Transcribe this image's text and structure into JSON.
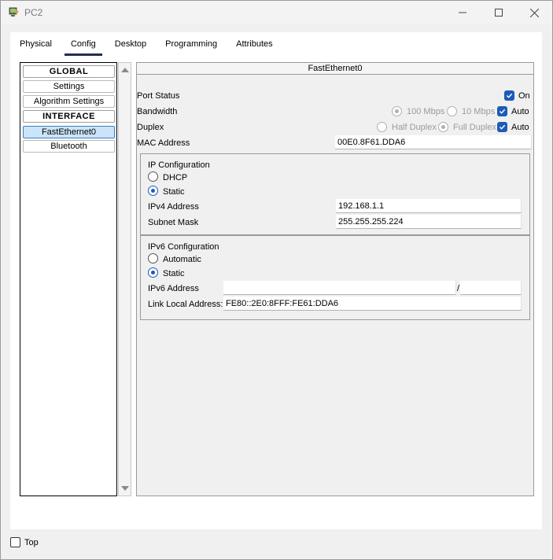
{
  "window": {
    "title": "PC2"
  },
  "tabs": [
    "Physical",
    "Config",
    "Desktop",
    "Programming",
    "Attributes"
  ],
  "sidebar": {
    "items": [
      {
        "label": "GLOBAL",
        "kind": "header"
      },
      {
        "label": "Settings",
        "kind": "item"
      },
      {
        "label": "Algorithm Settings",
        "kind": "item"
      },
      {
        "label": "INTERFACE",
        "kind": "header"
      },
      {
        "label": "FastEthernet0",
        "kind": "selected"
      },
      {
        "label": "Bluetooth",
        "kind": "item"
      }
    ]
  },
  "panel": {
    "title": "FastEthernet0",
    "port_status": {
      "label": "Port Status",
      "on_label": "On",
      "on_checked": true
    },
    "bandwidth": {
      "label": "Bandwidth",
      "opt_100": "100 Mbps",
      "opt_10": "10 Mbps",
      "auto_label": "Auto"
    },
    "duplex": {
      "label": "Duplex",
      "half": "Half Duplex",
      "full": "Full Duplex",
      "auto_label": "Auto"
    },
    "mac": {
      "label": "MAC Address",
      "value": "00E0.8F61.DDA6"
    },
    "ipv4": {
      "title": "IP Configuration",
      "dhcp_label": "DHCP",
      "static_label": "Static",
      "address_label": "IPv4 Address",
      "address_value": "192.168.1.1",
      "mask_label": "Subnet Mask",
      "mask_value": "255.255.255.224"
    },
    "ipv6": {
      "title": "IPv6 Configuration",
      "auto_label": "Automatic",
      "static_label": "Static",
      "address_label": "IPv6 Address",
      "address_value": "",
      "prefix_separator": "/",
      "prefix_value": "",
      "link_local_label": "Link Local Address:",
      "link_local_value": "FE80::2E0:8FFF:FE61:DDA6"
    }
  },
  "footer": {
    "top_label": "Top"
  },
  "colors": {
    "accent": "#1c5bb8",
    "tab_underline": "#1f2d50",
    "selected_item": "#cce4f7"
  }
}
